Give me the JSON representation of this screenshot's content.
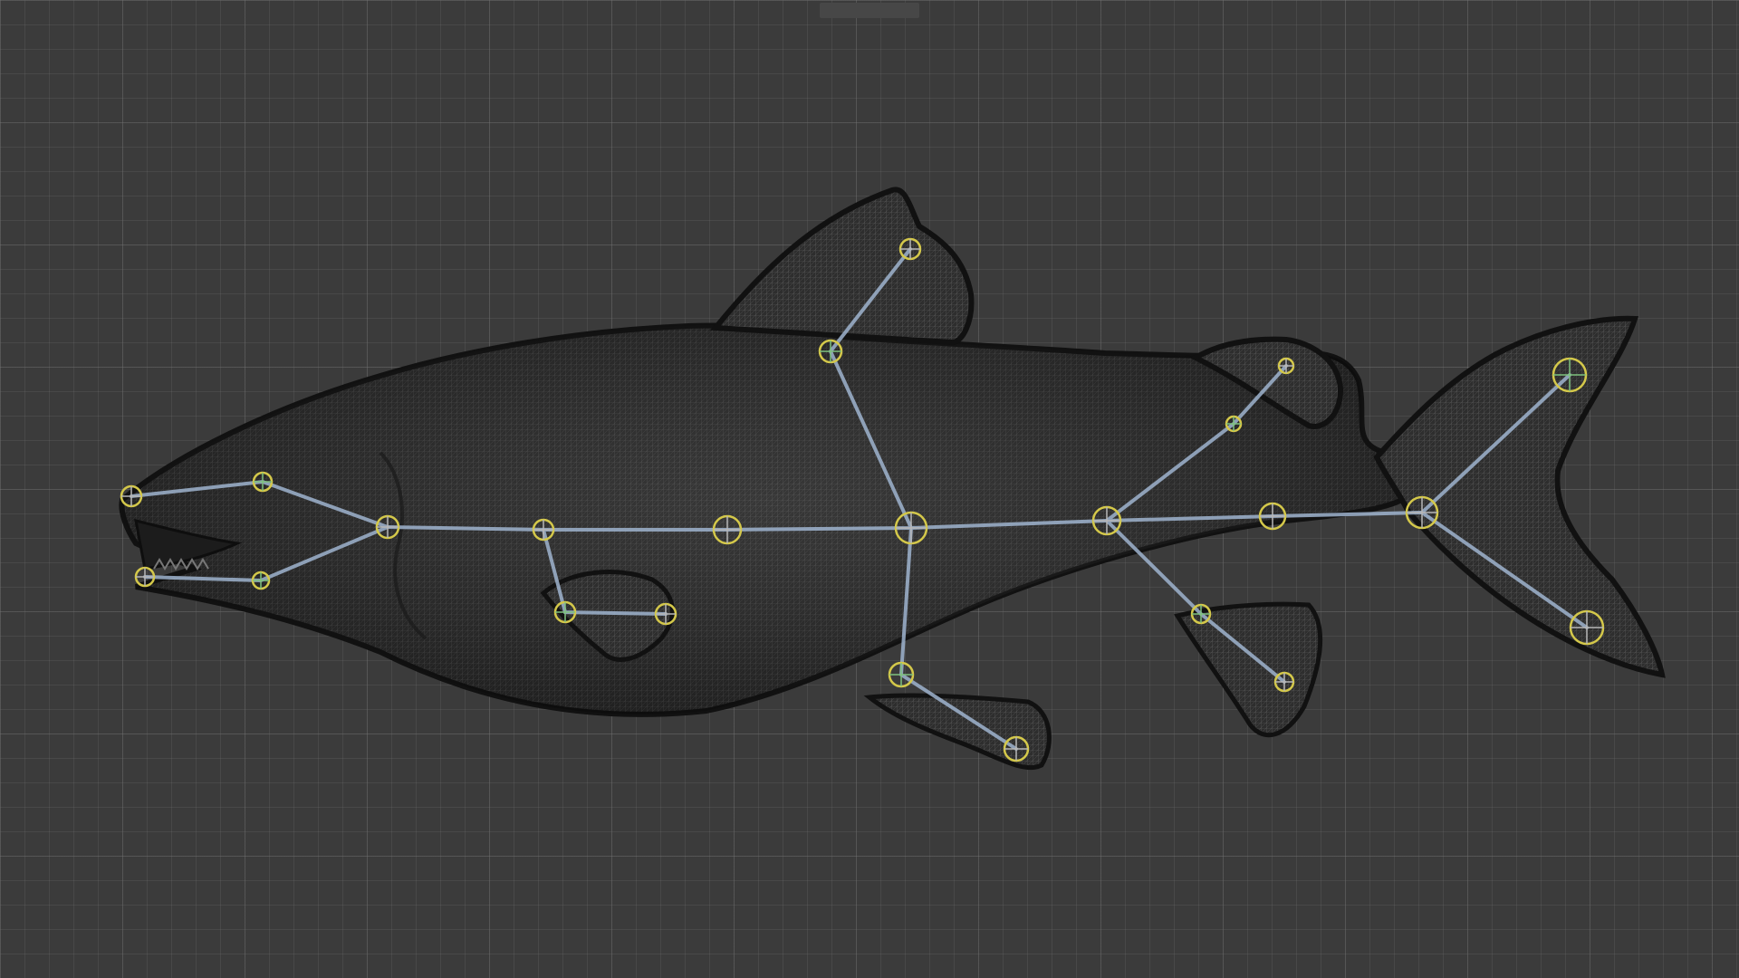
{
  "viewport": {
    "background_color": "#3b3b3b",
    "grid_color": "#5a5a5a"
  },
  "model": {
    "type": "rigged-fish-mesh",
    "mesh_color": "#3a3a3a",
    "wire_color": "#9a9a9a",
    "bone_color": "#9fb4cf",
    "joint_color": "#d4c84a"
  }
}
